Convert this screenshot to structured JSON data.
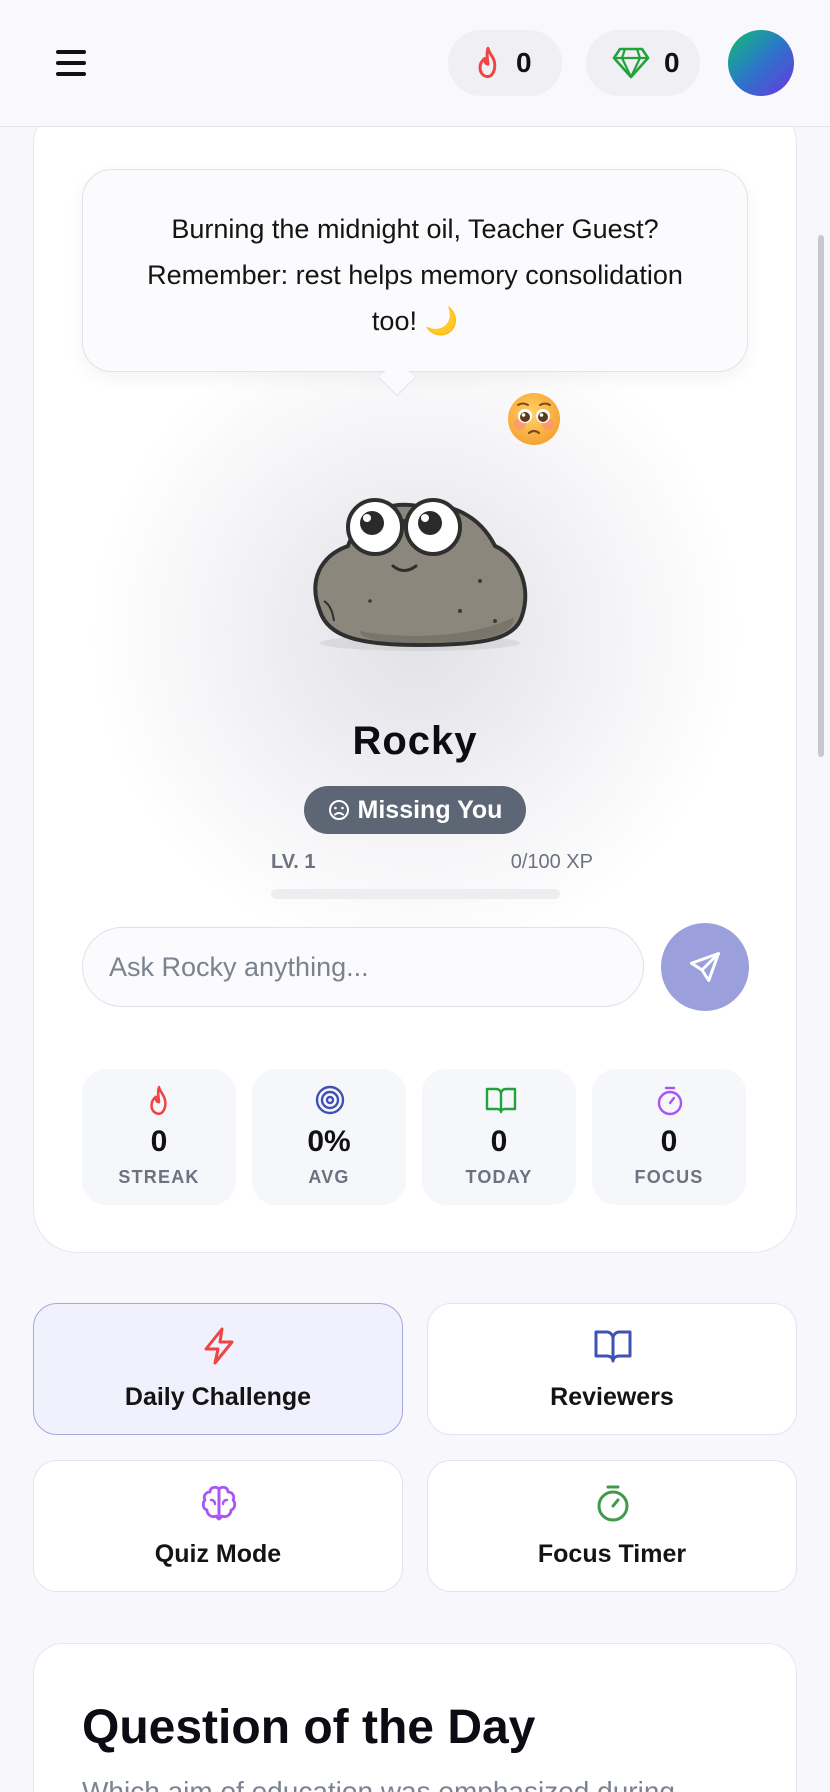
{
  "header": {
    "streak_count": "0",
    "gem_count": "0"
  },
  "pet": {
    "speech": "Burning the midnight oil, Teacher Guest? Remember: rest helps memory consolidation too! 🌙",
    "mood_emoji": "🥺",
    "name": "Rocky",
    "mood": "Missing You",
    "level_label": "LV. 1",
    "xp_label": "0/100 XP",
    "xp_progress": 0,
    "chat_placeholder": "Ask Rocky anything..."
  },
  "stats": [
    {
      "icon": "flame-icon",
      "value": "0",
      "label": "STREAK",
      "color": "#ef4444"
    },
    {
      "icon": "target-icon",
      "value": "0%",
      "label": "AVG",
      "color": "#3f51b5"
    },
    {
      "icon": "book-icon",
      "value": "0",
      "label": "TODAY",
      "color": "#22a33a"
    },
    {
      "icon": "stopwatch-icon",
      "value": "0",
      "label": "FOCUS",
      "color": "#a855f7"
    }
  ],
  "actions": [
    {
      "icon": "lightning-icon",
      "label": "Daily Challenge",
      "color": "#ef4444"
    },
    {
      "icon": "book-open-icon",
      "label": "Reviewers",
      "color": "#3f51b5"
    },
    {
      "icon": "brain-icon",
      "label": "Quiz Mode",
      "color": "#a855f7"
    },
    {
      "icon": "timer-icon",
      "label": "Focus Timer",
      "color": "#3f9a4a"
    }
  ],
  "qotd": {
    "title": "Question of the Day",
    "question": "Which aim of education was emphasized during"
  },
  "colors": {
    "accent": "#6366f1",
    "send_button": "#9ba0dc",
    "mood_badge": "#5d6675"
  }
}
